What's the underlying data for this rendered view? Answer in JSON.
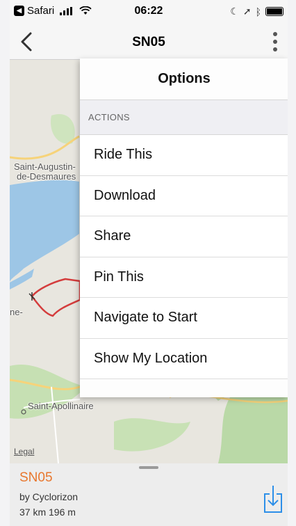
{
  "status_bar": {
    "back_app": "Safari",
    "time": "06:22"
  },
  "nav": {
    "title": "SN05"
  },
  "map": {
    "labels": [
      "Saint-Augustin-",
      "de-Desmaures",
      "ne-",
      "Saint-Apollinaire"
    ],
    "legal": "Legal",
    "water_color": "#9dc6e6",
    "route_color": "#d43d3d"
  },
  "options": {
    "title": "Options",
    "section": "ACTIONS",
    "items": [
      "Ride This",
      "Download",
      "Share",
      "Pin This",
      "Navigate to Start",
      "Show My Location"
    ]
  },
  "route_card": {
    "name": "SN05",
    "author": "by Cyclorizon",
    "distance": "37 km 196 m",
    "name_color": "#e8772e",
    "icon": "download-icon"
  }
}
